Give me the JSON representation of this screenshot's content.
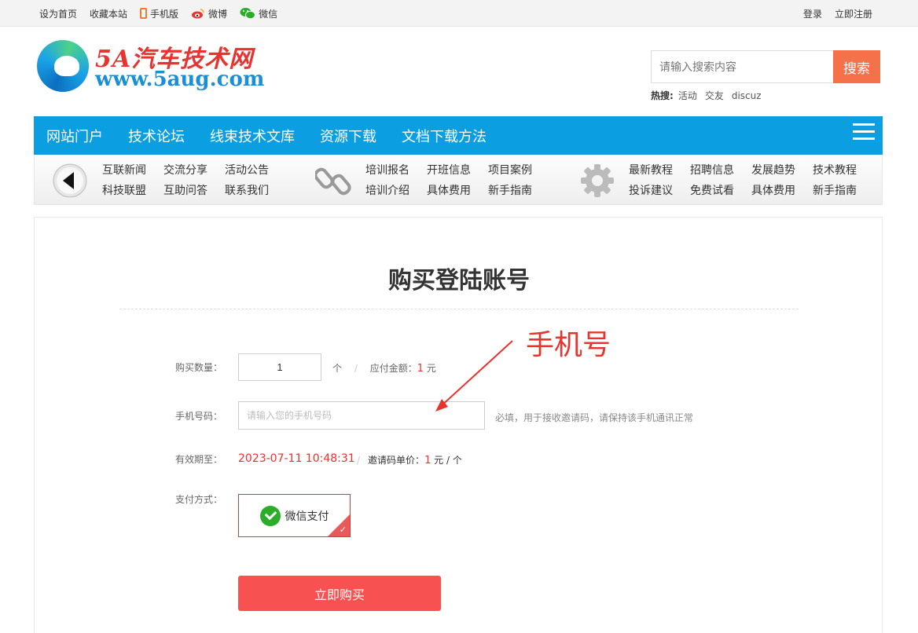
{
  "topbar": {
    "set_home": "设为首页",
    "favorite": "收藏本站",
    "mobile": "手机版",
    "weibo": "微博",
    "wechat": "微信",
    "login": "登录",
    "register": "立即注册"
  },
  "logo": {
    "title": "5A汽车技术网",
    "url": "www.5aug.com"
  },
  "search": {
    "placeholder": "请输入搜索内容",
    "button": "搜索",
    "hot_label": "热搜:",
    "hot_terms": [
      "活动",
      "交友",
      "discuz"
    ]
  },
  "nav": {
    "items": [
      "网站门户",
      "技术论坛",
      "线束技术文库",
      "资源下载",
      "文档下载方法"
    ]
  },
  "subnav": {
    "group1": [
      "互联新闻",
      "交流分享",
      "活动公告",
      "科技联盟",
      "互助问答",
      "联系我们"
    ],
    "group2": [
      "培训报名",
      "开班信息",
      "项目案例",
      "培训介绍",
      "具体费用",
      "新手指南"
    ],
    "group3": [
      "最新教程",
      "招聘信息",
      "发展趋势",
      "技术教程",
      "投诉建议",
      "免费试看",
      "具体费用",
      "新手指南"
    ]
  },
  "form": {
    "title": "购买登陆账号",
    "qty_label": "购买数量：",
    "qty_value": "1",
    "qty_unit": "个",
    "amount_label": "应付金额：",
    "amount_value": "1",
    "amount_unit": "元",
    "phone_label": "手机号码：",
    "phone_placeholder": "请输入您的手机号码",
    "phone_hint": "必填，用于接收邀请码，请保持该手机通讯正常",
    "expiry_label": "有效期至：",
    "expiry_value": "2023-07-11 10:48:31",
    "unit_price_label": "邀请码单价：",
    "unit_price_value": "1",
    "unit_price_unit": "元 / 个",
    "pay_label": "支付方式：",
    "pay_option": "微信支付",
    "buy_button": "立即购买"
  },
  "annotation": {
    "text": "手机号"
  },
  "colors": {
    "nav_blue": "#0b9ee0",
    "accent_red": "#e8332e",
    "search_orange": "#f5714a",
    "buy_red": "#f85151"
  }
}
